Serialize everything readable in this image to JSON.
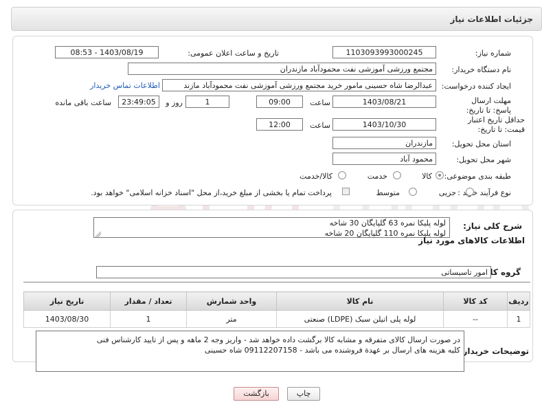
{
  "header": {
    "title": "جزئیات اطلاعات نیاز"
  },
  "form": {
    "need_number_label": "شماره نیاز:",
    "need_number": "1103093993000245",
    "announce_label": "تاریخ و ساعت اعلان عمومی:",
    "announce_value": "1403/08/19 - 08:53",
    "buyer_org_label": "نام دستگاه خریدار:",
    "buyer_org": "مجتمع ورزشی آموزشی نفت محمودآباد مازندران",
    "creator_label": "ایجاد کننده درخواست:",
    "creator": "عبدالرضا شاه حسینی مامور خرید مجتمع ورزشی آموزشی نفت محمودآباد مازند",
    "contact_link": "اطلاعات تماس خریدار",
    "reply_deadline_label": "مهلت ارسال پاسخ: تا تاریخ:",
    "reply_date": "1403/08/21",
    "time_label": "ساعت",
    "reply_time": "09:00",
    "days_value": "1",
    "days_label": "روز و",
    "remaining_time": "23:49:05",
    "remaining_label": "ساعت باقی مانده",
    "price_validity_label": "حداقل تاریخ اعتبار قیمت: تا تاریخ:",
    "price_validity_date": "1403/10/30",
    "price_validity_time": "12:00",
    "province_label": "استان محل تحویل:",
    "province": "مازندران",
    "city_label": "شهر محل تحویل:",
    "city": "محمود آباد",
    "category_label": "طبقه بندی موضوعی:",
    "category_options": [
      "کالا",
      "خدمت",
      "کالا/خدمت"
    ],
    "process_label": "نوع فرآیند خرید :",
    "process_options": [
      "جزیی",
      "متوسط"
    ],
    "payment_note": "پرداخت تمام یا بخشی از مبلغ خرید،از محل \"اسناد خزانه اسلامی\" خواهد بود."
  },
  "details": {
    "summary_label": "شرح کلی نیاز:",
    "summary_lines": [
      "لوله پلیکا نمره 63 گلپایگان  30 شاخه",
      "لوله پلیکا نمره 110 گلپایگان  20 شاخه"
    ],
    "items_heading": "اطلاعات کالاهای مورد نیاز",
    "group_label": "گروه کالا:",
    "group_value": "امور تاسیساتی",
    "table": {
      "headers": [
        "ردیف",
        "کد کالا",
        "نام کالا",
        "واحد شمارش",
        "تعداد / مقدار",
        "تاریخ نیاز"
      ],
      "rows": [
        [
          "1",
          "--",
          "لوله پلی اتیلن سبک (LDPE) صنعتی",
          "متر",
          "1",
          "1403/08/30"
        ]
      ]
    },
    "buyer_notes_label": "توضیحات خریدار:",
    "buyer_notes_lines": [
      "در صورت ارسال کالای متفرقه و مشابه کالا برگشت داده خواهد شد - واریز وجه 2 ماهه و پس از تایید کارشناس فنی",
      "کلیه هزینه های ارسال بر عهدة فروشنده می باشد - 09112207158 شاه حسینی"
    ]
  },
  "buttons": {
    "print": "چاپ",
    "back": "بازگشت"
  }
}
